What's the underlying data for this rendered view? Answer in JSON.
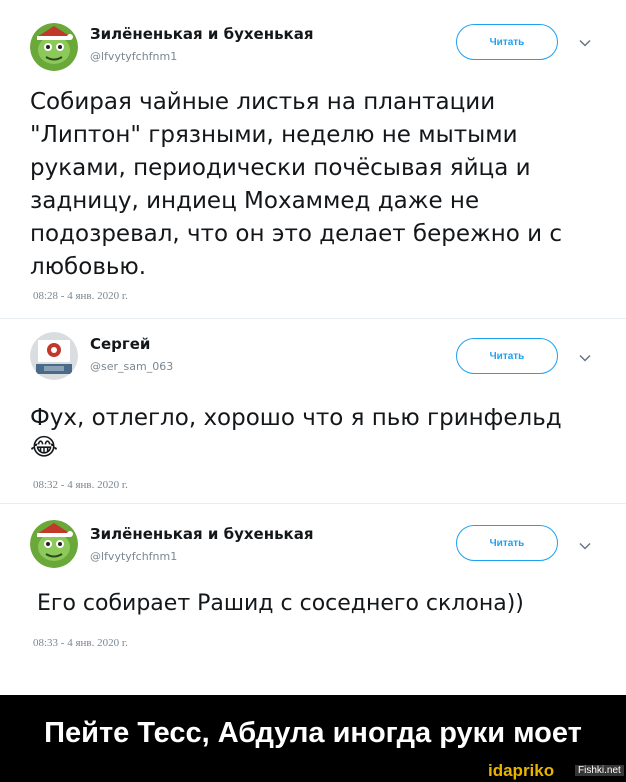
{
  "colors": {
    "accent": "#1da1f2",
    "meta_text": "#7a8791",
    "body_text": "#14171a",
    "banner_bg": "#000000",
    "banner_text": "#ffffff",
    "watermark": "#e9b400"
  },
  "tweets": [
    {
      "name": "Зилёненькая и бухенькая",
      "handle": "@lfvytyfchfnm1",
      "follow_label": "Читать",
      "text": "Собирая чайные листья на плантации \"Липтон\" грязными, неделю не мытыми руками, периодически почёсывая яйца и задницу, индиец Мохаммед даже не подозревал, что он это делает бережно и с любовью.",
      "time": "08:28 - 4 янв. 2020 г.",
      "avatar_icon": "green-cartoon-avatar-icon"
    },
    {
      "name": "Сергей",
      "handle": "@ser_sam_063",
      "follow_label": "Читать",
      "text": "Фух, отлегло, хорошо что я пью гринфельд",
      "emoji": "😂",
      "time": "08:32 - 4 янв. 2020 г.",
      "avatar_icon": "photo-avatar-icon"
    },
    {
      "name": "Зилёненькая и бухенькая",
      "handle": "@lfvytyfchfnm1",
      "follow_label": "Читать",
      "text": "Его собирает Рашид с соседнего склона))",
      "time": "08:33 - 4 янв. 2020 г.",
      "avatar_icon": "green-cartoon-avatar-icon"
    }
  ],
  "banner": {
    "caption": "Пейте Тесс, Абдула иногда руки моет",
    "watermark_primary": "idapriko",
    "watermark_secondary": "Fishki.net"
  }
}
